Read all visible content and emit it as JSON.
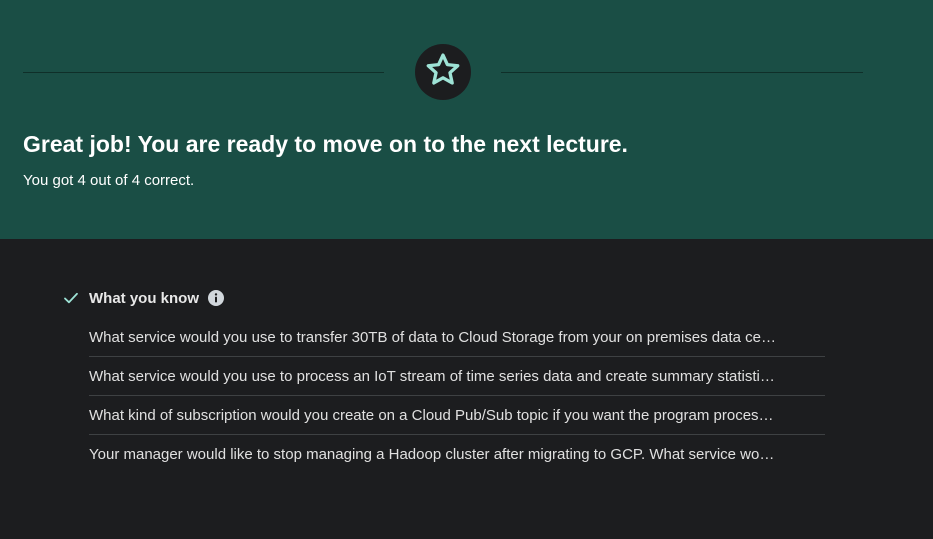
{
  "hero": {
    "icon": "star-icon",
    "title": "Great job! You are ready to move on to the next lecture.",
    "subtitle": "You got 4 out of 4 correct."
  },
  "results": {
    "section_icon": "check-icon",
    "section_title": "What you know",
    "info_icon": "info-icon",
    "questions": [
      "What service would you use to transfer 30TB of data to Cloud Storage from your on premises data ce…",
      "What service would you use to process an IoT stream of time series data and create summary statisti…",
      "What kind of subscription would you create on a Cloud Pub/Sub topic if you want the program proces…",
      "Your manager would like to stop managing a Hadoop cluster after migrating to GCP. What service wo…"
    ]
  },
  "colors": {
    "hero_background": "#1a4e45",
    "page_background": "#1c1d1f",
    "accent": "#9ee3d6"
  }
}
